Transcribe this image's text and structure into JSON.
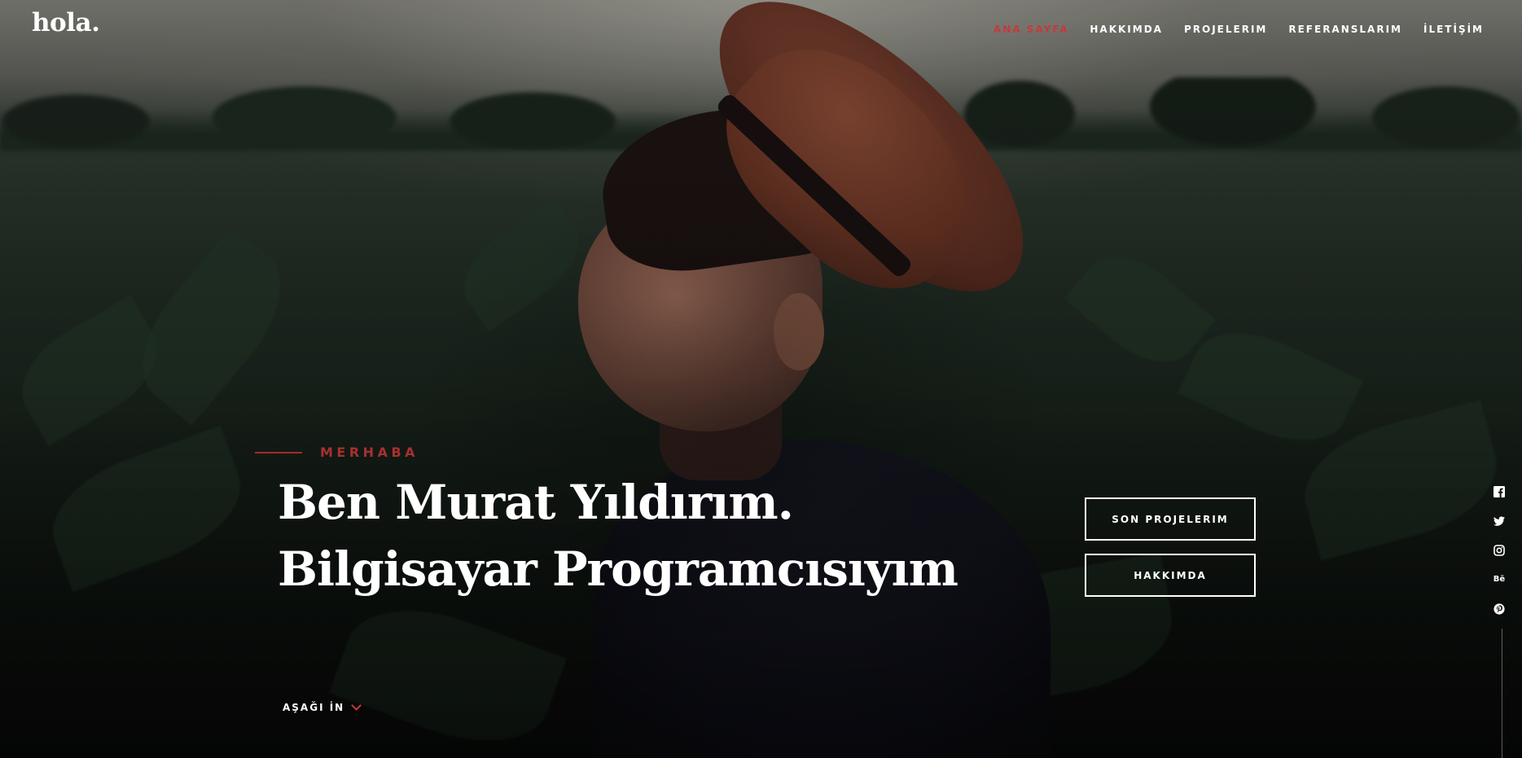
{
  "brand": {
    "logo": "hola."
  },
  "nav": {
    "items": [
      {
        "label": "ANA SAYFA",
        "active": true
      },
      {
        "label": "HAKKIMDA",
        "active": false
      },
      {
        "label": "PROJELERIM",
        "active": false
      },
      {
        "label": "REFERANSLARIM",
        "active": false
      },
      {
        "label": "İLETİŞİM",
        "active": false
      }
    ]
  },
  "hero": {
    "intro": "MERHABA",
    "headline_line1": "Ben Murat Yıldırım.",
    "headline_line2": "Bilgisayar Programcısıyım",
    "buttons": {
      "projects": "SON PROJELERIM",
      "about": "HAKKIMDA"
    },
    "scroll_label": "AŞAĞI İN"
  },
  "social": {
    "icons": [
      "facebook-icon",
      "twitter-icon",
      "instagram-icon",
      "behance-icon",
      "pinterest-icon"
    ],
    "behance_text": "Bē"
  },
  "colors": {
    "accent": "#c53a3a",
    "text": "#ffffff"
  }
}
